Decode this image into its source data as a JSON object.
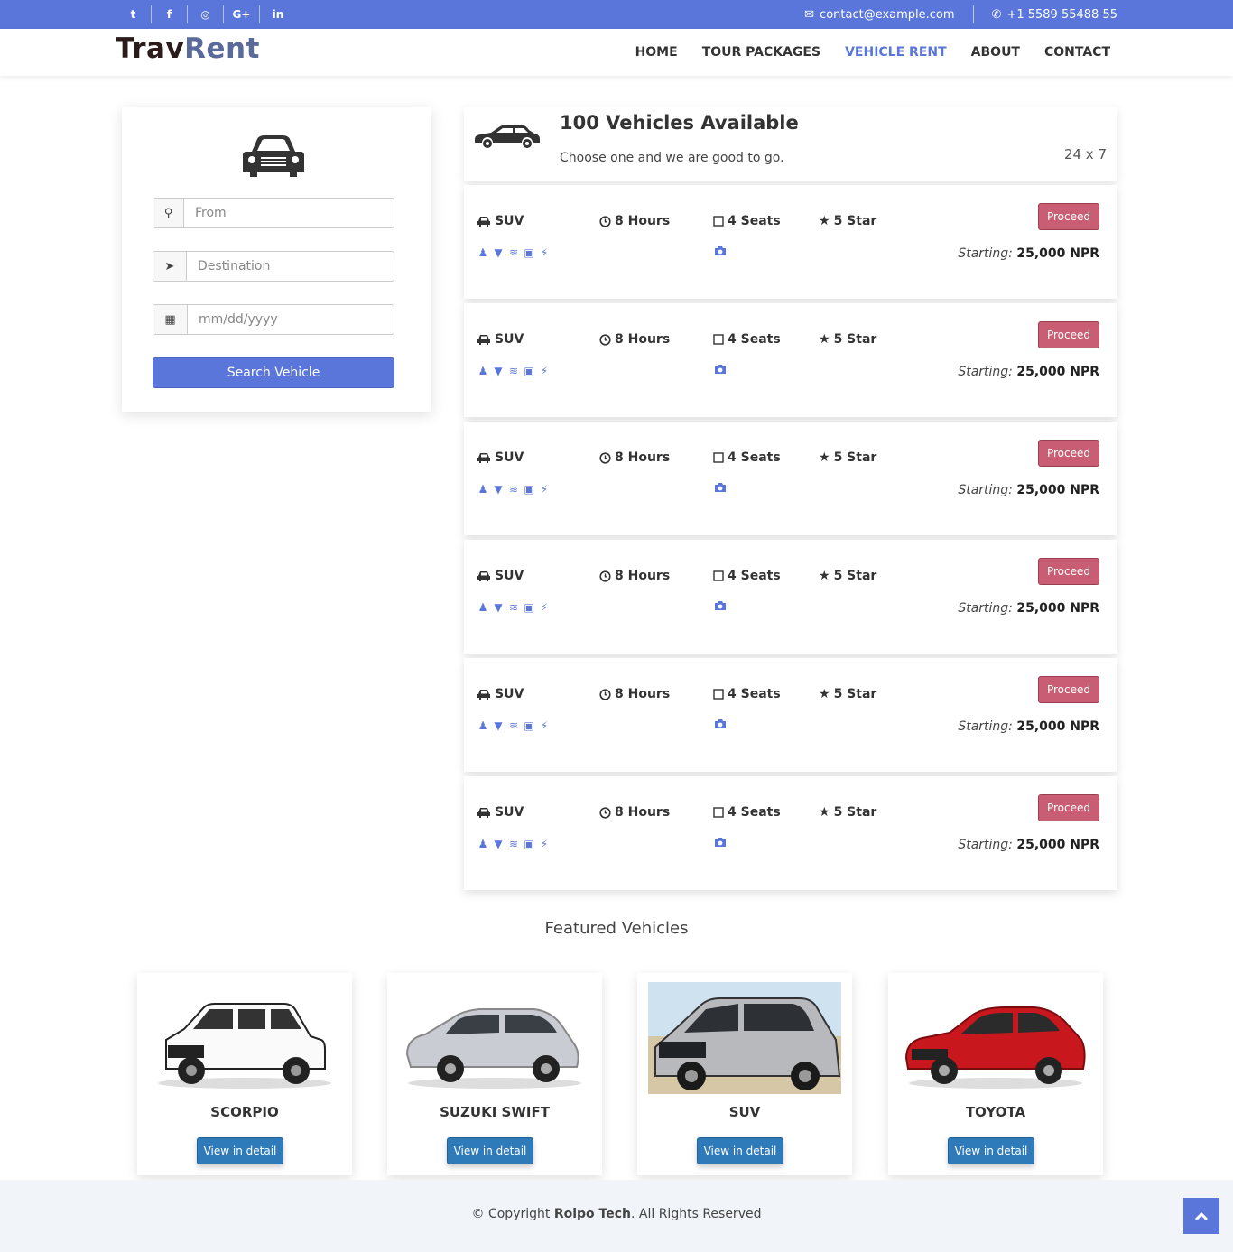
{
  "topbar": {
    "social": [
      "twitter",
      "facebook",
      "instagram",
      "google-plus",
      "linkedin"
    ],
    "social_glyphs": [
      "t",
      "f",
      "◎",
      "G+",
      "in"
    ],
    "email": "contact@example.com",
    "phone": "+1 5589 55488 55"
  },
  "header": {
    "logo_a": "Trav",
    "logo_b": "Rent",
    "nav": [
      "HOME",
      "TOUR PACKAGES",
      "VEHICLE RENT",
      "ABOUT",
      "CONTACT"
    ],
    "active": "VEHICLE RENT"
  },
  "search": {
    "from_placeholder": "From",
    "destination_placeholder": "Destination",
    "date_placeholder": "mm/dd/yyyy",
    "button": "Search Vehicle"
  },
  "results": {
    "title": "100 Vehicles Available",
    "subtitle": "Choose one and we are good to go.",
    "tag": "24 x 7"
  },
  "vehicles": [
    {
      "type": "SUV",
      "hours": "8 Hours",
      "seats": "4 Seats",
      "rating": "5 Star",
      "button": "Proceed",
      "price_label": "Starting:",
      "price": "25,000 NPR"
    },
    {
      "type": "SUV",
      "hours": "8 Hours",
      "seats": "4 Seats",
      "rating": "5 Star",
      "button": "Proceed",
      "price_label": "Starting:",
      "price": "25,000 NPR"
    },
    {
      "type": "SUV",
      "hours": "8 Hours",
      "seats": "4 Seats",
      "rating": "5 Star",
      "button": "Proceed",
      "price_label": "Starting:",
      "price": "25,000 NPR"
    },
    {
      "type": "SUV",
      "hours": "8 Hours",
      "seats": "4 Seats",
      "rating": "5 Star",
      "button": "Proceed",
      "price_label": "Starting:",
      "price": "25,000 NPR"
    },
    {
      "type": "SUV",
      "hours": "8 Hours",
      "seats": "4 Seats",
      "rating": "5 Star",
      "button": "Proceed",
      "price_label": "Starting:",
      "price": "25,000 NPR"
    },
    {
      "type": "SUV",
      "hours": "8 Hours",
      "seats": "4 Seats",
      "rating": "5 Star",
      "button": "Proceed",
      "price_label": "Starting:",
      "price": "25,000 NPR"
    }
  ],
  "featured": {
    "title": "Featured Vehicles",
    "items": [
      {
        "name": "SCORPIO",
        "button": "View in detail",
        "color": "#ffffff"
      },
      {
        "name": "SUZUKI SWIFT",
        "button": "View in detail",
        "color": "#c9ccd3"
      },
      {
        "name": "SUV",
        "button": "View in detail",
        "color": "#b7b9bc"
      },
      {
        "name": "TOYOTA",
        "button": "View in detail",
        "color": "#c8171d"
      }
    ]
  },
  "footer": {
    "prefix": "© Copyright ",
    "company": "Rolpo Tech",
    "suffix": ". All Rights Reserved"
  },
  "colors": {
    "accent": "#5a76db",
    "proceed": "#c85d73",
    "view_button": "#2f7ab9"
  }
}
